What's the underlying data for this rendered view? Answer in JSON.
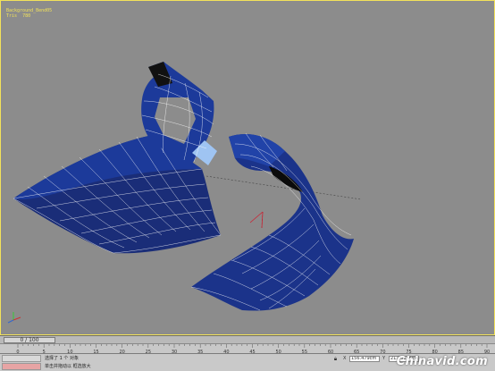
{
  "viewport": {
    "stats_line1": "Background_Bend05",
    "stats_line2_label": "Tris",
    "stats_line2_value": "780",
    "mesh_color": "#1f3d9c",
    "wire_color": "#ffffff"
  },
  "timeline": {
    "frame_display": "0 / 100"
  },
  "ruler": {
    "ticks": [
      "0",
      "5",
      "10",
      "15",
      "20",
      "25",
      "30",
      "35",
      "40",
      "45",
      "50",
      "55",
      "60",
      "65",
      "70",
      "75",
      "80",
      "85",
      "90"
    ]
  },
  "status": {
    "line1": "选择了 1 个 对象",
    "line2": "单击并拖动以 框选放大",
    "x_value": "156.479cm",
    "y_value": "211.615cm",
    "z_value": "0.0cm"
  },
  "watermark": "Chinavid.com",
  "icons": [
    "lock-icon",
    "key-icon",
    "axis-gizmo-icon"
  ]
}
